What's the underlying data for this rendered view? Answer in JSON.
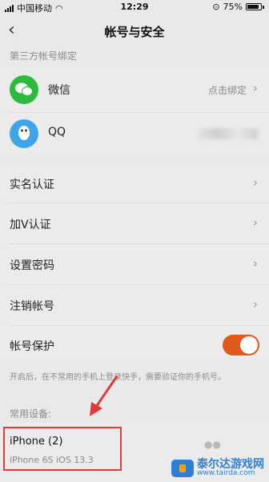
{
  "status_bar": {
    "carrier": "中国移动",
    "time": "12:29",
    "battery": "75%"
  },
  "nav": {
    "title": "帐号与安全"
  },
  "third_party": {
    "section_label": "第三方帐号绑定",
    "items": [
      {
        "name": "微信",
        "action": "点击绑定",
        "icon": "wechat-icon"
      },
      {
        "name": "QQ",
        "action": "",
        "icon": "qq-icon"
      }
    ]
  },
  "settings": {
    "items": [
      {
        "label": "实名认证"
      },
      {
        "label": "加V认证"
      },
      {
        "label": "设置密码"
      },
      {
        "label": "注销帐号"
      }
    ],
    "protection": {
      "label": "帐号保护",
      "enabled": true
    },
    "hint": "开启后，在不常用的手机上登录快手，需要验证你的手机号。"
  },
  "devices": {
    "section_label": "常用设备:",
    "items": [
      {
        "name": "iPhone (2)",
        "model": "iPhone 6S iOS 13.3"
      }
    ]
  },
  "watermark": {
    "title": "泰尔达游戏网",
    "url": "www.tairda.com"
  },
  "colors": {
    "toggle_on": "#e05a1c",
    "highlight": "#e23a3a",
    "wechat": "#2dbb3e",
    "qq": "#3ea6e8"
  }
}
